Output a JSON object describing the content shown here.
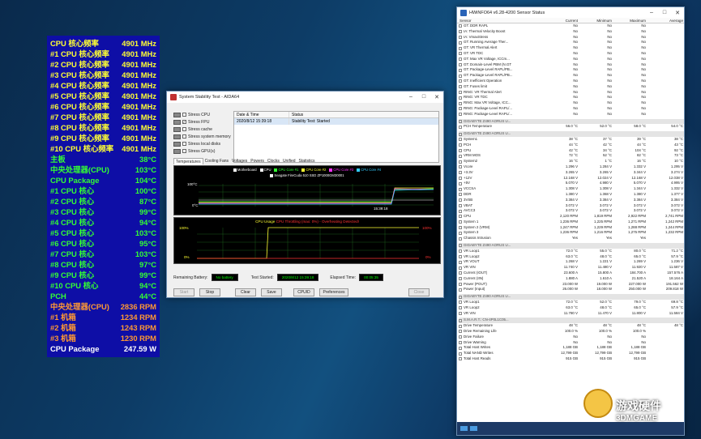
{
  "osd": {
    "rows": [
      {
        "label": "CPU 核心频率",
        "value": "4901 MHz",
        "color": "#ffff33"
      },
      {
        "label": "#1 CPU 核心频率",
        "value": "4901 MHz",
        "color": "#ffff33"
      },
      {
        "label": "#2 CPU 核心频率",
        "value": "4901 MHz",
        "color": "#ffff33"
      },
      {
        "label": "#3 CPU 核心频率",
        "value": "4901 MHz",
        "color": "#ffff33"
      },
      {
        "label": "#4 CPU 核心频率",
        "value": "4901 MHz",
        "color": "#ffff33"
      },
      {
        "label": "#5 CPU 核心频率",
        "value": "4901 MHz",
        "color": "#ffff33"
      },
      {
        "label": "#6 CPU 核心频率",
        "value": "4901 MHz",
        "color": "#ffff33"
      },
      {
        "label": "#7 CPU 核心频率",
        "value": "4901 MHz",
        "color": "#ffff33"
      },
      {
        "label": "#8 CPU 核心频率",
        "value": "4901 MHz",
        "color": "#ffff33"
      },
      {
        "label": "#9 CPU 核心频率",
        "value": "4901 MHz",
        "color": "#ffff33"
      },
      {
        "label": "#10 CPU 核心频率",
        "value": "4901 MHz",
        "color": "#ffff33"
      },
      {
        "label": "主板",
        "value": "38°C",
        "color": "#33ff33"
      },
      {
        "label": "中央处理器(CPU)",
        "value": "103°C",
        "color": "#33ff33"
      },
      {
        "label": "CPU Package",
        "value": "104°C",
        "color": "#33ff33"
      },
      {
        "label": "#1 CPU 核心",
        "value": "100°C",
        "color": "#33ff33"
      },
      {
        "label": "#2 CPU 核心",
        "value": "87°C",
        "color": "#33ff33"
      },
      {
        "label": "#3 CPU 核心",
        "value": "99°C",
        "color": "#33ff33"
      },
      {
        "label": "#4 CPU 核心",
        "value": "94°C",
        "color": "#33ff33"
      },
      {
        "label": "#5 CPU 核心",
        "value": "103°C",
        "color": "#33ff33"
      },
      {
        "label": "#6 CPU 核心",
        "value": "95°C",
        "color": "#33ff33"
      },
      {
        "label": "#7 CPU 核心",
        "value": "103°C",
        "color": "#33ff33"
      },
      {
        "label": "#8 CPU 核心",
        "value": "97°C",
        "color": "#33ff33"
      },
      {
        "label": "#9 CPU 核心",
        "value": "99°C",
        "color": "#33ff33"
      },
      {
        "label": "#10 CPU 核心",
        "value": "94°C",
        "color": "#33ff33"
      },
      {
        "label": "PCH",
        "value": "44°C",
        "color": "#33ff33"
      },
      {
        "label": "中央处理器(CPU)",
        "value": "2836 RPM",
        "color": "#ff9933"
      },
      {
        "label": "#1 机箱",
        "value": "1234 RPM",
        "color": "#ff9933"
      },
      {
        "label": "#2 机箱",
        "value": "1243 RPM",
        "color": "#ff9933"
      },
      {
        "label": "#3 机箱",
        "value": "1230 RPM",
        "color": "#ff9933"
      },
      {
        "label": "CPU Package",
        "value": "247.59 W",
        "color": "#ffffff"
      }
    ]
  },
  "aida": {
    "title": "System Stability Test - AIDA64",
    "stress_items": [
      {
        "label": "Stress CPU",
        "checked": false
      },
      {
        "label": "Stress FPU",
        "checked": true
      },
      {
        "label": "Stress cache",
        "checked": false
      },
      {
        "label": "Stress system memory",
        "checked": false
      },
      {
        "label": "Stress local disks",
        "checked": false
      },
      {
        "label": "Stress GPU(s)",
        "checked": false
      }
    ],
    "status_header": {
      "date": "Date & Time",
      "status": "Status"
    },
    "status_row": {
      "date": "2020/8/12 15:39:18",
      "status": "Stability Test: Started"
    },
    "tabs": [
      "Temperatures",
      "Cooling Fans",
      "Voltages",
      "Powers",
      "Clocks",
      "Unified",
      "Statistics"
    ],
    "legend": [
      {
        "label": "Motherboard",
        "color": "#ffffff"
      },
      {
        "label": "CPU",
        "color": "#ffffff"
      },
      {
        "label": "CPU Core #1",
        "color": "#33ff33"
      },
      {
        "label": "CPU Core #2",
        "color": "#ffff33"
      },
      {
        "label": "CPU Core #3",
        "color": "#ff33ff"
      },
      {
        "label": "CPU Core #4",
        "color": "#33ccff"
      }
    ],
    "legend2": "Seagate FireCuda 510 SSD ZP1000GM30001",
    "g1_top": "100°C",
    "g1_bottom": "0°C",
    "g1_time": "15:39:18",
    "g2_title": "CPU Usage",
    "g2_title2": "CPU Throttling (max: 0%) - Overheating Detected!",
    "g2_top_left": "100%",
    "g2_bottom_left": "0%",
    "g2_top_right": "100%",
    "g2_bottom_right": "0%",
    "battery_label": "Remaining Battery:",
    "battery_value": "No battery",
    "started_label": "Test Started:",
    "started_value": "2020/8/12 15:39:18",
    "elapsed_label": "Elapsed Time:",
    "elapsed_value": "00:05:35",
    "buttons": [
      "Start",
      "Stop",
      "Clear",
      "Save",
      "CPUID",
      "Preferences",
      "Close"
    ]
  },
  "hwinfo": {
    "title": "HWiNFO64 v6.28-4200 Sensor Status",
    "headers": {
      "sensor": "Sensor",
      "current": "Current",
      "minimum": "Minimum",
      "maximum": "Maximum",
      "average": "Average"
    },
    "rows": [
      {
        "n": "GT: DDR RAPL",
        "c": "No",
        "mi": "No",
        "ma": "No",
        "a": ""
      },
      {
        "n": "IA: Thermal Velocity Boost",
        "c": "No",
        "mi": "No",
        "ma": "No",
        "a": ""
      },
      {
        "n": "IA: VmaxStress",
        "c": "No",
        "mi": "No",
        "ma": "No",
        "a": ""
      },
      {
        "n": "GT: Running Average Ther...",
        "c": "No",
        "mi": "No",
        "ma": "No",
        "a": ""
      },
      {
        "n": "GT: VR Thermal Alert",
        "c": "No",
        "mi": "No",
        "ma": "No",
        "a": ""
      },
      {
        "n": "GT: VR TDC",
        "c": "No",
        "mi": "No",
        "ma": "No",
        "a": ""
      },
      {
        "n": "GT: Max VR Voltage, ICCm...",
        "c": "No",
        "mi": "No",
        "ma": "No",
        "a": ""
      },
      {
        "n": "GT: Domain-Level PBM (N.GT",
        "c": "No",
        "mi": "No",
        "ma": "No",
        "a": ""
      },
      {
        "n": "GT: Package-Level RAPL/PB...",
        "c": "No",
        "mi": "No",
        "ma": "No",
        "a": ""
      },
      {
        "n": "GT: Package-Level RAPL/PB...",
        "c": "No",
        "mi": "No",
        "ma": "No",
        "a": ""
      },
      {
        "n": "GT: Inefficient Operation",
        "c": "No",
        "mi": "No",
        "ma": "No",
        "a": ""
      },
      {
        "n": "GT: Fuses limit",
        "c": "No",
        "mi": "No",
        "ma": "No",
        "a": ""
      },
      {
        "n": "RING: VR Thermal Alert",
        "c": "No",
        "mi": "No",
        "ma": "No",
        "a": ""
      },
      {
        "n": "RING: VR TDC",
        "c": "No",
        "mi": "No",
        "ma": "No",
        "a": ""
      },
      {
        "n": "RING: Max VR Voltage, ICC...",
        "c": "No",
        "mi": "No",
        "ma": "No",
        "a": ""
      },
      {
        "n": "RING: Package-Level RAPL/...",
        "c": "No",
        "mi": "No",
        "ma": "No",
        "a": ""
      },
      {
        "n": "RING: Package-Level RAPL/...",
        "c": "No",
        "mi": "No",
        "ma": "No",
        "a": ""
      },
      {
        "sec": "GIGABYTE Z490 AORUS U..."
      },
      {
        "n": "PCH Temperature",
        "c": "56.0 °C",
        "mi": "52.0 °C",
        "ma": "58.0 °C",
        "a": "54.0 °C"
      },
      {
        "sec": "GIGABYTE Z490 AORUS U..."
      },
      {
        "n": "System1",
        "c": "38 °C",
        "mi": "37 °C",
        "ma": "39 °C",
        "a": "38 °C"
      },
      {
        "n": "PCH",
        "c": "44 °C",
        "mi": "42 °C",
        "ma": "44 °C",
        "a": "43 °C"
      },
      {
        "n": "CPU",
        "c": "42 °C",
        "mi": "34 °C",
        "ma": "104 °C",
        "a": "92 °C"
      },
      {
        "n": "VRM MOS",
        "c": "72 °C",
        "mi": "52 °C",
        "ma": "82 °C",
        "a": "73 °C"
      },
      {
        "n": "System2",
        "c": "16 °C",
        "mi": "1 °C",
        "ma": "16 °C",
        "a": "10 °C"
      },
      {
        "n": "Vcore",
        "c": "1.296 V",
        "mi": "1.284 V",
        "ma": "1.332 V",
        "a": "1.295 V"
      },
      {
        "n": "+3.3V",
        "c": "3.265 V",
        "mi": "3.265 V",
        "ma": "3.344 V",
        "a": "3.274 V"
      },
      {
        "n": "+12V",
        "c": "12.168 V",
        "mi": "12.024 V",
        "ma": "12.168 V",
        "a": "12.038 V"
      },
      {
        "n": "+5V",
        "c": "5.070 V",
        "mi": "4.980 V",
        "ma": "5.070 V",
        "a": "4.995 V"
      },
      {
        "n": "VCCSA",
        "c": "1.308 V",
        "mi": "1.308 V",
        "ma": "1.344 V",
        "a": "1.332 V"
      },
      {
        "n": "DDR",
        "c": "1.380 V",
        "mi": "1.368 V",
        "ma": "1.380 V",
        "a": "1.377 V"
      },
      {
        "n": "3VSB",
        "c": "3.384 V",
        "mi": "3.384 V",
        "ma": "3.384 V",
        "a": "3.384 V"
      },
      {
        "n": "VBAT",
        "c": "3.072 V",
        "mi": "3.072 V",
        "ma": "3.072 V",
        "a": "3.072 V"
      },
      {
        "n": "AVCC3",
        "c": "3.072 V",
        "mi": "3.072 V",
        "ma": "3.072 V",
        "a": "3.072 V"
      },
      {
        "n": "CPU",
        "c": "2,120 RPM",
        "mi": "1,819 RPM",
        "ma": "2,922 RPM",
        "a": "2,741 RPM"
      },
      {
        "n": "System 1",
        "c": "1,236 RPM",
        "mi": "1,225 RPM",
        "ma": "1,271 RPM",
        "a": "1,242 RPM"
      },
      {
        "n": "System 2 (VRM)",
        "c": "1,247 RPM",
        "mi": "1,229 RPM",
        "ma": "1,288 RPM",
        "a": "1,244 RPM"
      },
      {
        "n": "System 3",
        "c": "1,236 RPM",
        "mi": "1,216 RPM",
        "ma": "1,275 RPM",
        "a": "1,232 RPM"
      },
      {
        "n": "Chassis Intrusion",
        "c": "Yes",
        "mi": "Yes",
        "ma": "Yes",
        "a": ""
      },
      {
        "sec": "GIGABYTE Z490 AORUS U..."
      },
      {
        "n": "VR Loop1",
        "c": "72.0 °C",
        "mi": "55.0 °C",
        "ma": "80.0 °C",
        "a": "71.2 °C"
      },
      {
        "n": "VR Loop2",
        "c": "63.0 °C",
        "mi": "48.0 °C",
        "ma": "65.0 °C",
        "a": "57.9 °C"
      },
      {
        "n": "VR VOUT",
        "c": "1.268 V",
        "mi": "1.221 V",
        "ma": "1.269 V",
        "a": "1.236 V"
      },
      {
        "n": "VR VIN",
        "c": "11.740 V",
        "mi": "11.480 V",
        "ma": "11.920 V",
        "a": "11.587 V"
      },
      {
        "n": "Current (IOUT)",
        "c": "23.600 A",
        "mi": "15.800 A",
        "ma": "184.700 A",
        "a": "157.576 A"
      },
      {
        "n": "Current (IIN)",
        "c": "1.880 A",
        "mi": "1.610 A",
        "ma": "21.520 A",
        "a": "18.164 A"
      },
      {
        "n": "Power (POUT)",
        "c": "23.000 W",
        "mi": "19.000 W",
        "ma": "227.000 W",
        "a": "191.562 W"
      },
      {
        "n": "Power (Input)",
        "c": "26.000 W",
        "mi": "18.000 W",
        "ma": "250.000 W",
        "a": "209.818 W"
      },
      {
        "sec": "GIGABYTE Z490 AORUS U..."
      },
      {
        "n": "VR Loop1",
        "c": "72.0 °C",
        "mi": "52.0 °C",
        "ma": "79.0 °C",
        "a": "69.8 °C"
      },
      {
        "n": "VR Loop2",
        "c": "63.0 °C",
        "mi": "48.0 °C",
        "ma": "65.0 °C",
        "a": "57.9 °C"
      },
      {
        "n": "VR VIN",
        "c": "11.780 V",
        "mi": "11.470 V",
        "ma": "11.800 V",
        "a": "11.584 V"
      },
      {
        "sec": "S.M.A.R.T.: CN-4P0L1C05..."
      },
      {
        "n": "Drive Temperature",
        "c": "48 °C",
        "mi": "48 °C",
        "ma": "48 °C",
        "a": "48 °C"
      },
      {
        "n": "Drive Remaining Life",
        "c": "100.0 %",
        "mi": "100.0 %",
        "ma": "100.0 %",
        "a": ""
      },
      {
        "n": "Drive Failure",
        "c": "No",
        "mi": "No",
        "ma": "No",
        "a": ""
      },
      {
        "n": "Drive Warning",
        "c": "No",
        "mi": "No",
        "ma": "No",
        "a": ""
      },
      {
        "n": "Total Host Writes",
        "c": "1,188 GB",
        "mi": "1,188 GB",
        "ma": "1,188 GB",
        "a": ""
      },
      {
        "n": "Total NAND Writes",
        "c": "12,799 GB",
        "mi": "12,799 GB",
        "ma": "12,799 GB",
        "a": ""
      },
      {
        "n": "Total Host Reads",
        "c": "915 GB",
        "mi": "915 GB",
        "ma": "915 GB",
        "a": ""
      }
    ]
  },
  "watermark": {
    "line1": "游戏硬件",
    "line2": "3DMGAME"
  }
}
